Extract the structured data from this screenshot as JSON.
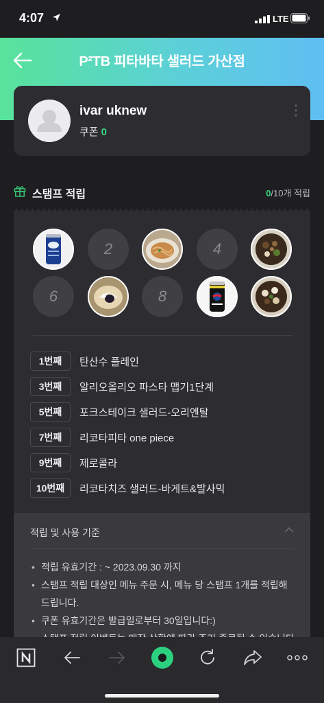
{
  "status_bar": {
    "time": "4:07",
    "network": "LTE"
  },
  "header": {
    "title": "P²TB 피타바타 샐러드 가산점"
  },
  "profile": {
    "name": "ivar uknew",
    "coupon_label": "쿠폰",
    "coupon_count": "0"
  },
  "stamps": {
    "title": "스탬프 적립",
    "current": "0",
    "total_text": "/10개 적립",
    "slots": [
      {
        "label": "1",
        "filled": true,
        "icon": "soda-can-icon"
      },
      {
        "label": "2",
        "filled": false
      },
      {
        "label": "3",
        "filled": true,
        "icon": "pasta-bowl-icon"
      },
      {
        "label": "4",
        "filled": false
      },
      {
        "label": "5",
        "filled": true,
        "icon": "salad-bowl-icon"
      },
      {
        "label": "6",
        "filled": false
      },
      {
        "label": "7",
        "filled": true,
        "icon": "pita-icon"
      },
      {
        "label": "8",
        "filled": false
      },
      {
        "label": "9",
        "filled": true,
        "icon": "cola-can-icon"
      },
      {
        "label": "10",
        "filled": true,
        "icon": "salad-bowl-icon"
      }
    ]
  },
  "rewards": [
    {
      "order": "1번째",
      "item": "탄산수 플레인"
    },
    {
      "order": "3번째",
      "item": "알리오올리오 파스타 맵기1단계"
    },
    {
      "order": "5번째",
      "item": "포크스테이크 샐러드-오리엔탈"
    },
    {
      "order": "7번째",
      "item": "리코타피타 one piece"
    },
    {
      "order": "9번째",
      "item": "제로콜라"
    },
    {
      "order": "10번째",
      "item": "리코타치즈 샐러드-바게트&발사믹"
    }
  ],
  "criteria": {
    "title": "적립 및 사용 기준",
    "items": [
      "적립 유효기간 : ~ 2023.09.30 까지",
      "스탬프 적립 대상인 메뉴 주문 시, 메뉴 당 스탬프 1개를 적립해 드립니다.",
      "쿠폰 유효기간은 발급일로부터 30일입니다:)",
      "스탬프 적립 이벤트는 매장 상황에 따라 조기 종료될 수 있습니다."
    ]
  },
  "colors": {
    "accent": "#3ad27e",
    "background": "#1e1e21",
    "card": "#2d2d31"
  }
}
